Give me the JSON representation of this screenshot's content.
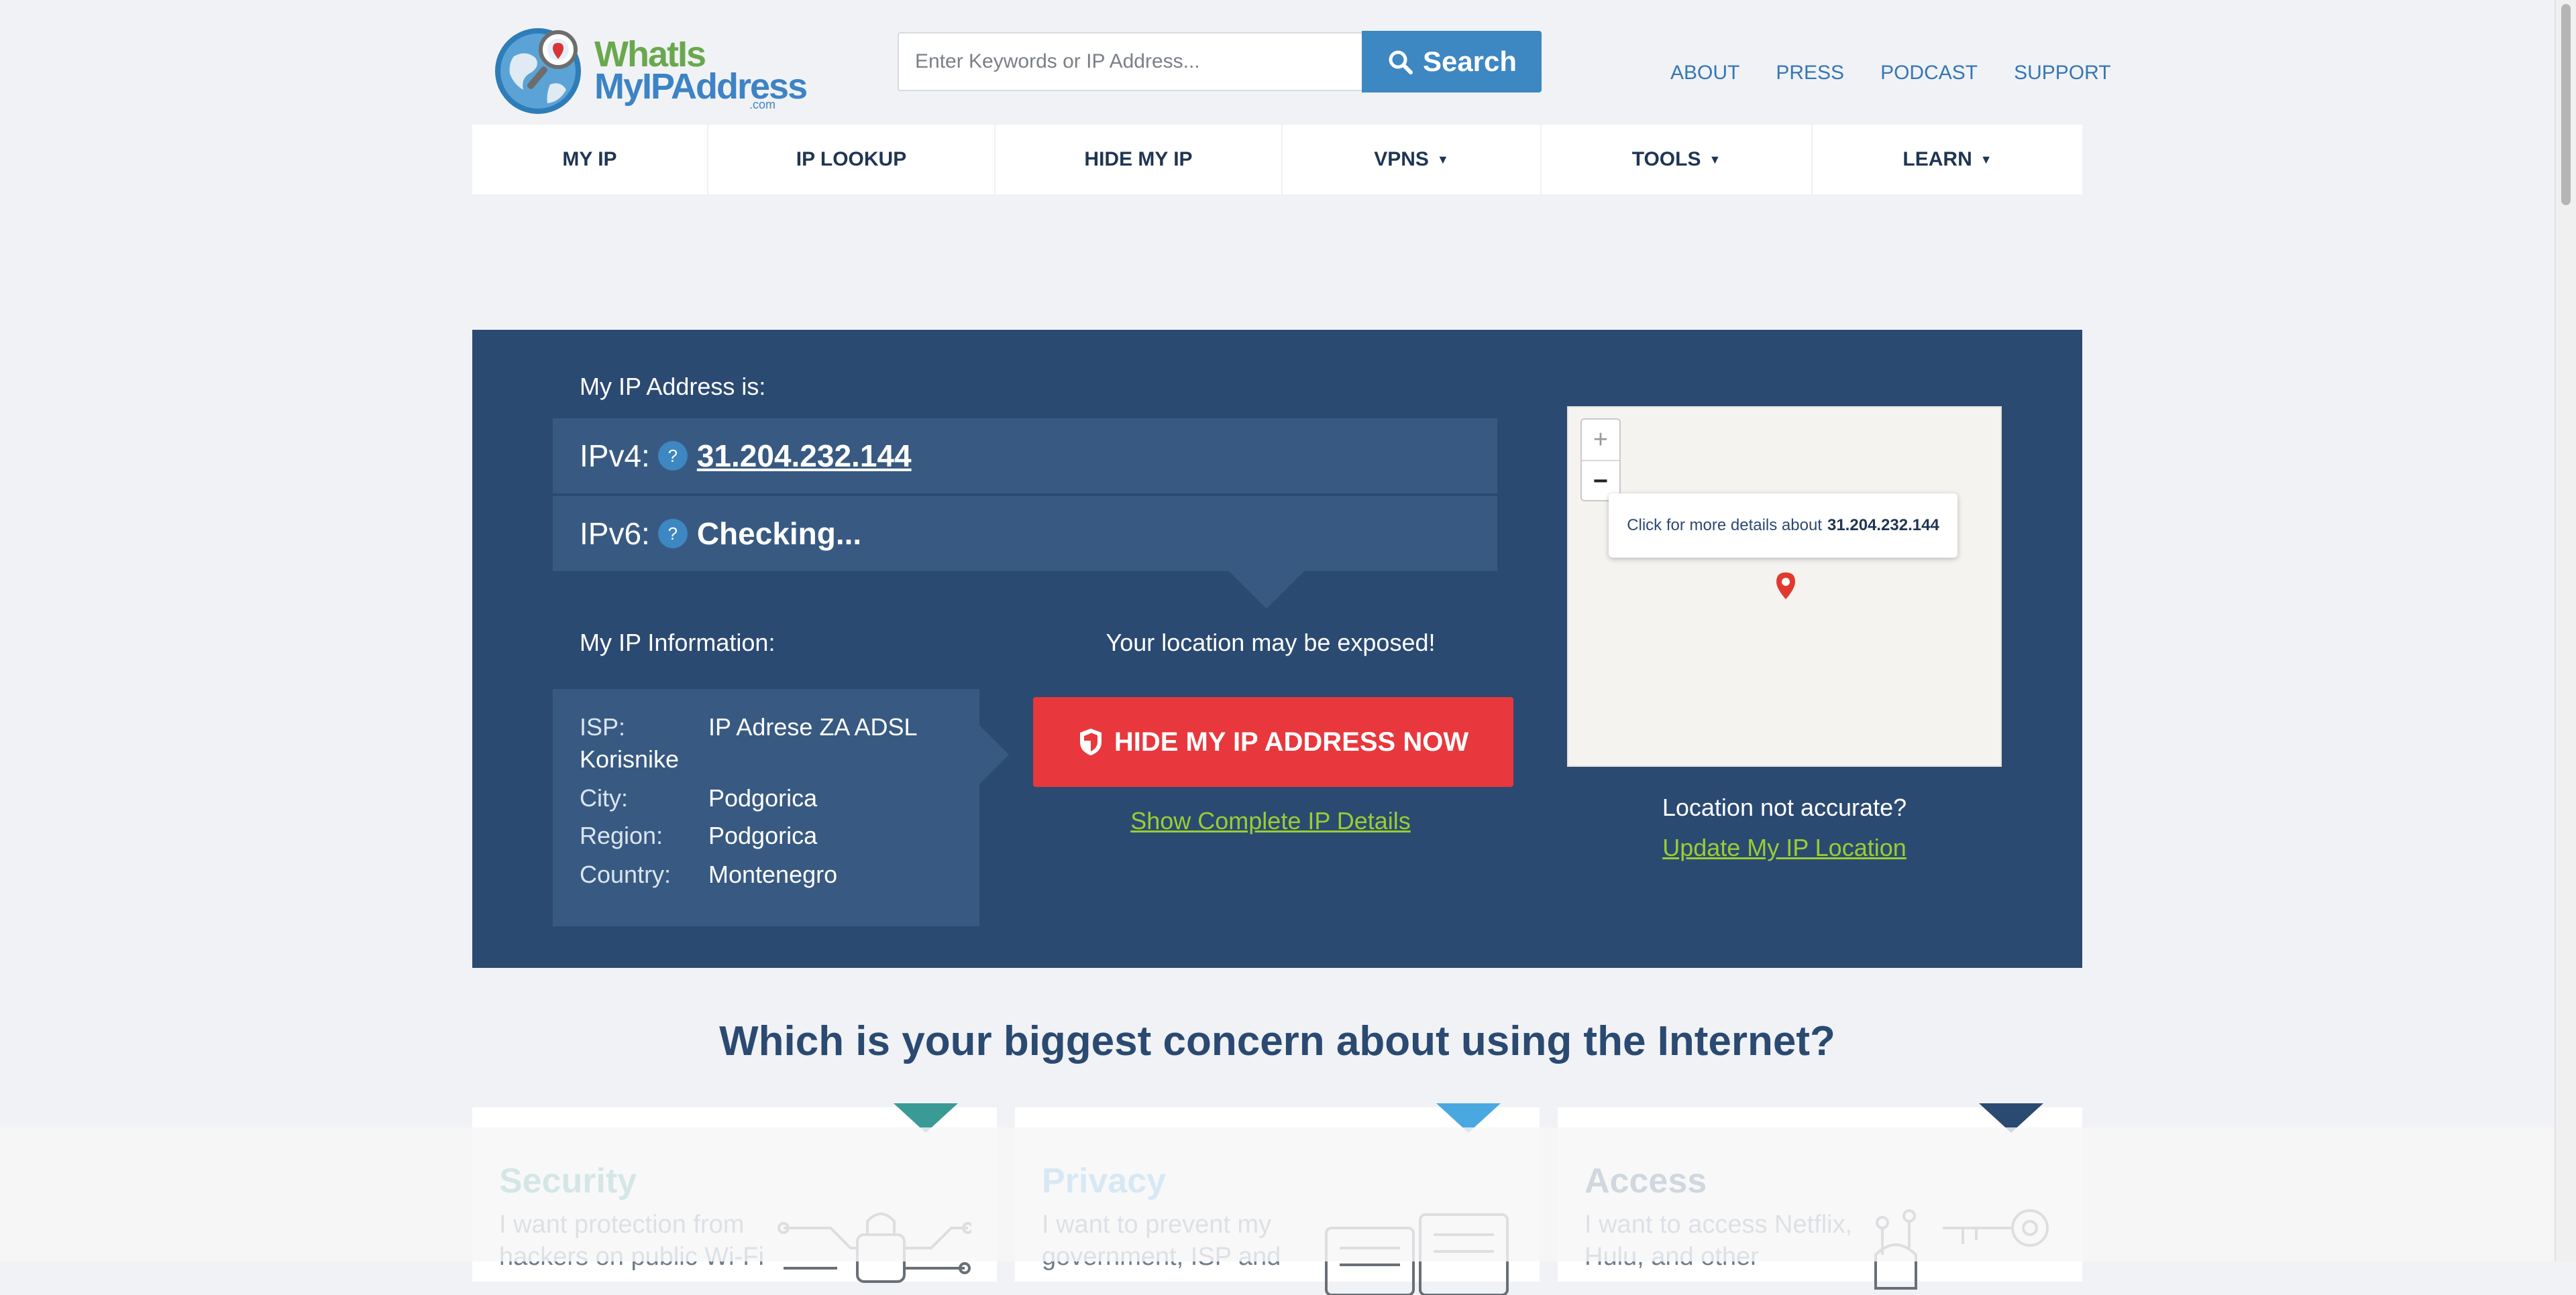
{
  "header": {
    "logo": {
      "line1": "WhatIs",
      "line2": "MyIPAddress",
      "suffix": ".com"
    },
    "search": {
      "placeholder": "Enter Keywords or IP Address...",
      "button_label": "Search"
    },
    "links": [
      "ABOUT",
      "PRESS",
      "PODCAST",
      "SUPPORT"
    ]
  },
  "nav": {
    "items": [
      {
        "label": "MY IP",
        "dropdown": false
      },
      {
        "label": "IP LOOKUP",
        "dropdown": false
      },
      {
        "label": "HIDE MY IP",
        "dropdown": false
      },
      {
        "label": "VPNS",
        "dropdown": true
      },
      {
        "label": "TOOLS",
        "dropdown": true
      },
      {
        "label": "LEARN",
        "dropdown": true
      }
    ],
    "caret": "▼"
  },
  "hero": {
    "ip_heading": "My IP Address is:",
    "ipv4": {
      "label": "IPv4:",
      "help": "?",
      "value": "31.204.232.144"
    },
    "ipv6": {
      "label": "IPv6:",
      "help": "?",
      "value": "Checking..."
    },
    "info_heading": "My IP Information:",
    "info": {
      "isp_key": "ISP:",
      "isp_value_line1": "IP Adrese ZA ADSL",
      "isp_value_line2": "Korisnike",
      "city_key": "City:",
      "city_value": "Podgorica",
      "region_key": "Region:",
      "region_value": "Podgorica",
      "country_key": "Country:",
      "country_value": "Montenegro"
    },
    "exposed_text": "Your location may be exposed!",
    "hide_button": "HIDE MY IP ADDRESS NOW",
    "details_link": "Show Complete IP Details",
    "map": {
      "zoom_in": "+",
      "zoom_out": "−",
      "popup_text": "Click for more details about",
      "popup_ip": "31.204.232.144"
    },
    "location_question": "Location not accurate?",
    "location_link": "Update My IP Location"
  },
  "concern": {
    "title": "Which is your biggest concern about using the Internet?",
    "cards": [
      {
        "title": "Security",
        "text": "I want protection from hackers on public Wi-Fi",
        "color": "#3a9a96"
      },
      {
        "title": "Privacy",
        "text": "I want to prevent my government, ISP and",
        "color": "#4aa8e0"
      },
      {
        "title": "Access",
        "text": "I want to access Netflix, Hulu, and other",
        "color": "#2b4a72"
      }
    ]
  },
  "colors": {
    "background": "#f1f2f5",
    "hero": "#2b4a72",
    "panel": "#385a82",
    "accent_blue": "#3d87c2",
    "danger": "#e8383d",
    "link_green": "#9acd32"
  }
}
